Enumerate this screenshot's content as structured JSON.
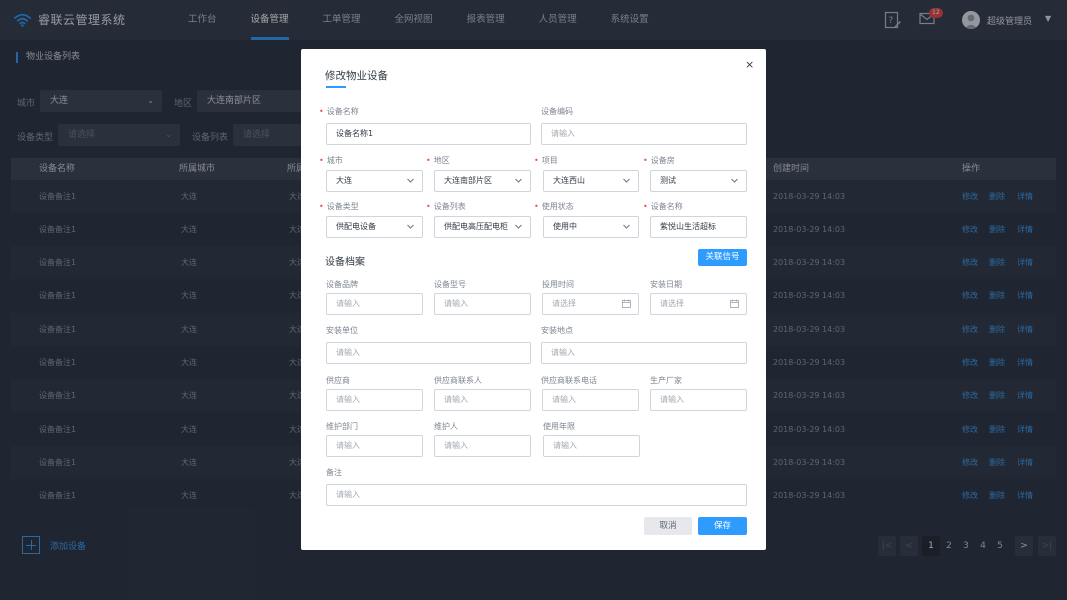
{
  "app": {
    "title": "睿联云管理系统"
  },
  "nav": [
    "工作台",
    "设备管理",
    "工单管理",
    "全网视图",
    "报表管理",
    "人员管理",
    "系统设置"
  ],
  "nav_active": 1,
  "header": {
    "mail_count": "12",
    "user_name": "超级管理员",
    "caret": "▼"
  },
  "page": {
    "title": "物业设备列表",
    "filters": {
      "city_label": "城市",
      "city_value": "大连",
      "area_label": "地区",
      "area_value": "大连南部片区",
      "type_label": "设备类型",
      "type_placeholder": "请选择",
      "list_label": "设备列表",
      "list_placeholder": "请选择"
    },
    "table": {
      "headers": [
        "设备名称",
        "所属城市",
        "所属",
        "创建时间",
        "操作"
      ],
      "rows": [
        [
          "设备备注1",
          "大连",
          "大连",
          "2018-03-29 14:03"
        ],
        [
          "设备备注1",
          "大连",
          "大连",
          "2018-03-29 14:03"
        ],
        [
          "设备备注1",
          "大连",
          "大连",
          "2018-03-29 14:03"
        ],
        [
          "设备备注1",
          "大连",
          "大连",
          "2018-03-29 14:03"
        ],
        [
          "设备备注1",
          "大连",
          "大连",
          "2018-03-29 14:03"
        ],
        [
          "设备备注1",
          "大连",
          "大连",
          "2018-03-29 14:03"
        ],
        [
          "设备备注1",
          "大连",
          "大连",
          "2018-03-29 14:03"
        ],
        [
          "设备备注1",
          "大连",
          "大连",
          "2018-03-29 14:03"
        ],
        [
          "设备备注1",
          "大连",
          "大连",
          "2018-03-29 14:03"
        ],
        [
          "设备备注1",
          "大连",
          "大连",
          "2018-03-29 14:03"
        ]
      ],
      "actions": [
        "修改",
        "删除",
        "详情"
      ]
    },
    "add_label": "添加设备",
    "pagination": {
      "first": "|<",
      "prev": "<",
      "pages": [
        "1",
        "2",
        "3",
        "4",
        "5"
      ],
      "current": "1",
      "next": ">",
      "last": ">|"
    }
  },
  "modal": {
    "title": "修改物业设备",
    "close": "×",
    "device_name_label": "设备名称",
    "device_name_value": "设备名称1",
    "device_code_label": "设备编码",
    "device_code_placeholder": "请输入",
    "city_label": "城市",
    "city_value": "大连",
    "area_label": "地区",
    "area_value": "大连南部片区",
    "project_label": "项目",
    "project_value": "大连西山",
    "room_label": "设备房",
    "room_value": "测试",
    "type_label": "设备类型",
    "type_value": "供配电设备",
    "list_label": "设备列表",
    "list_value": "供配电高压配电柜",
    "status_label": "使用状态",
    "status_value": "使用中",
    "name2_label": "设备名称",
    "name2_value": "紫悦山生活超标",
    "section_title": "设备档案",
    "link_button": "关联信号",
    "brand_label": "设备品牌",
    "brand_placeholder": "请输入",
    "model_label": "设备型号",
    "model_placeholder": "请输入",
    "use_time_label": "投用时间",
    "use_time_placeholder": "请选择",
    "install_date_label": "安装日期",
    "install_date_placeholder": "请选择",
    "install_unit_label": "安装单位",
    "install_unit_placeholder": "请输入",
    "install_place_label": "安装地点",
    "install_place_placeholder": "请输入",
    "supplier_label": "供应商",
    "supplier_placeholder": "请输入",
    "supplier_contact_label": "供应商联系人",
    "supplier_contact_placeholder": "请输入",
    "supplier_phone_label": "供应商联系电话",
    "supplier_phone_placeholder": "请输入",
    "maker_label": "生产厂家",
    "maker_placeholder": "请输入",
    "maint_dept_label": "维护部门",
    "maint_dept_placeholder": "请输入",
    "maintainer_label": "维护人",
    "maintainer_placeholder": "请输入",
    "years_label": "使用年限",
    "years_placeholder": "请输入",
    "remark_label": "备注",
    "remark_placeholder": "请输入",
    "cancel": "取消",
    "save": "保存"
  },
  "colors": {
    "accent": "#2e9bff",
    "required": "#f05050",
    "background": "#2a3140",
    "topbar": "#323a49"
  }
}
